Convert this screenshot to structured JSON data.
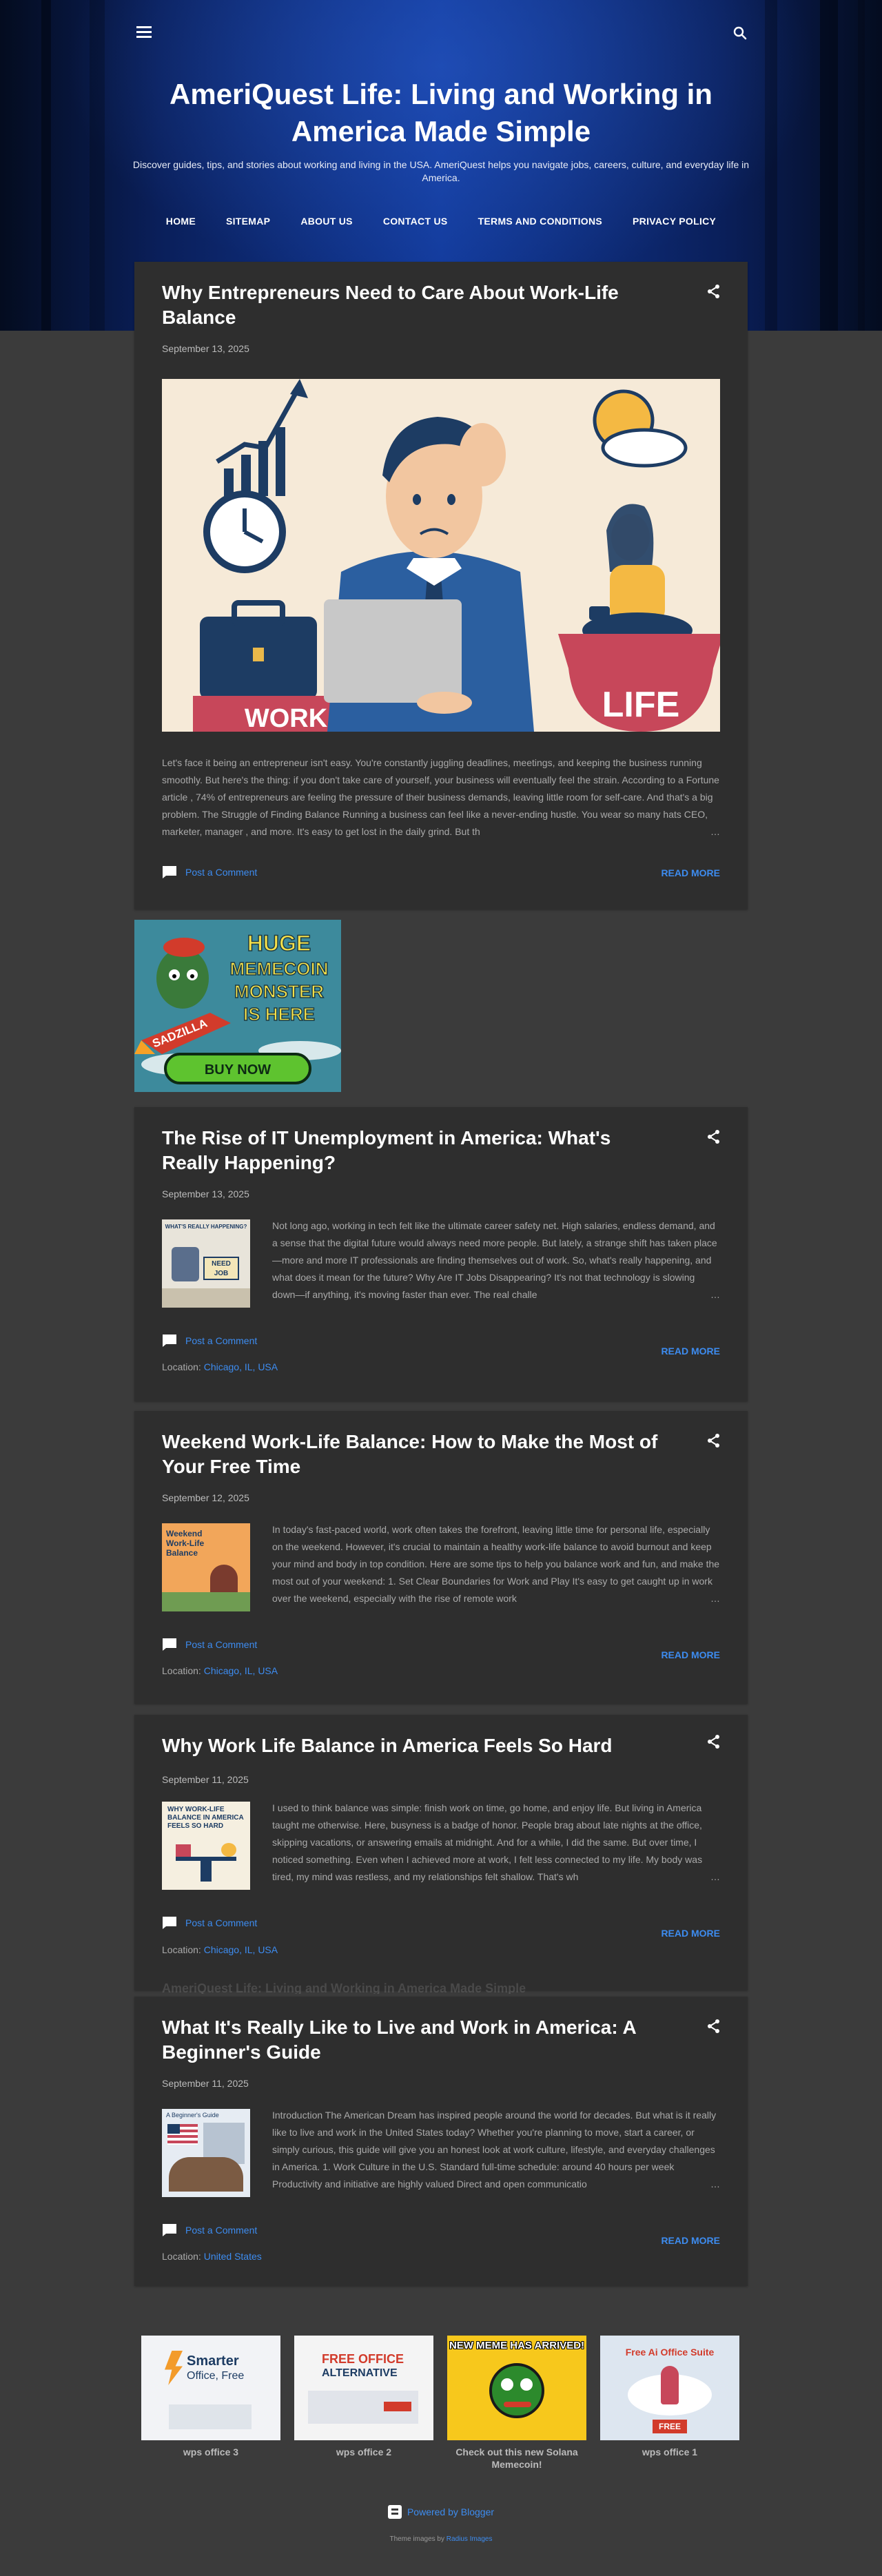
{
  "header": {
    "title": "AmeriQuest Life: Living and Working in America Made Simple",
    "description": "Discover guides, tips, and stories about working and living in the USA. AmeriQuest helps you navigate jobs, careers, culture, and everyday life in America."
  },
  "nav": [
    "HOME",
    "SITEMAP",
    "ABOUT US",
    "CONTACT US",
    "TERMS AND CONDITIONS",
    "PRIVACY POLICY"
  ],
  "labels": {
    "post_comment": "Post a Comment",
    "read_more": "READ MORE",
    "location_prefix": "Location:",
    "ellipsis": "…"
  },
  "featured": {
    "title": "Why Entrepreneurs Need to Care About Work-Life Balance",
    "date": "September 13, 2025",
    "image_text_left": "WORK",
    "image_text_right": "LIFE",
    "snippet": "Let's face it being an entrepreneur isn't easy. You're constantly juggling deadlines, meetings, and keeping the business running smoothly. But here's the thing: if you don't take care of yourself, your business will eventually feel the strain. According to a Fortune article , 74% of entrepreneurs are feeling the pressure of their business demands, leaving little room for self-care. And that's a big problem. The Struggle of Finding Balance Running a business can feel like a never-ending hustle. You wear so many hats  CEO, marketer, manager , and more. It's easy to get lost in the daily grind. But th"
  },
  "ad": {
    "line1": "HUGE",
    "line2": "MEMECOIN",
    "line3": "MONSTER",
    "line4": "IS HERE",
    "rocket": "SADZILLA",
    "button": "BUY NOW"
  },
  "posts": [
    {
      "title": "The Rise of IT Unemployment in America: What's Really Happening?",
      "date": "September 13, 2025",
      "thumb_caption": "WHAT'S REALLY HAPPENING?",
      "thumb_sign": "NEED JOB",
      "snippet": "Not long ago, working in tech felt like the ultimate career safety net. High salaries, endless demand, and a sense that the digital future would always need more people. But lately, a strange shift has taken place—more and more IT professionals are finding themselves out of work. So, what's really happening, and what does it mean for the future? Why Are IT Jobs Disappearing? It's not that technology is slowing down—if anything, it's moving faster than ever. The real challe",
      "location": "Chicago, IL, USA"
    },
    {
      "title": "Weekend Work-Life Balance: How to Make the Most of Your Free Time",
      "date": "September 12, 2025",
      "thumb_caption": "Weekend Work-Life Balance",
      "snippet": "In today's fast-paced world, work often takes the forefront, leaving little time for personal life, especially on the weekend. However, it's crucial to maintain a healthy work-life balance to avoid burnout and keep your mind and body in top condition. Here are some tips to help you balance work and fun, and make the most out of your weekend: 1. Set Clear Boundaries for Work and Play It's easy to get caught up in work over the weekend, especially with the rise of remote work",
      "location": "Chicago, IL, USA"
    },
    {
      "title": "Why Work Life Balance in America Feels So Hard",
      "date": "September 11, 2025",
      "thumb_caption": "WHY WORK-LIFE BALANCE IN AMERICA FEELS SO HARD",
      "snippet": "  I used to think balance was simple: finish work on time, go home, and enjoy life. But living in America taught me otherwise. Here, busyness is a badge of honor. People brag about late nights at the office, skipping vacations, or answering emails at midnight. And for a while, I did the same. But over time, I noticed something. Even when I achieved more at work, I felt less connected to my life. My body was tired, my mind was restless, and my relationships felt shallow. That's wh",
      "location": "Chicago, IL, USA"
    },
    {
      "title": "What It's Really Like to Live and Work in America: A Beginner's Guide",
      "date": "September 11, 2025",
      "thumb_caption": "A Beginner's Guide",
      "snippet": "Introduction The American Dream has inspired people around the world for decades. But what is it really like to live and work in the United States today? Whether you're planning to move, start a career, or simply curious, this guide will give you an honest look at work culture, lifestyle, and everyday challenges in America. 1. Work Culture in the U.S. Standard full-time schedule: around 40 hours per week Productivity and initiative are highly valued Direct and open communicatio",
      "location": "United States"
    }
  ],
  "ghost_title": "AmeriQuest Life: Living and Working in America Made Simple",
  "gadgets": [
    {
      "caption": "wps office 3",
      "img_line1": "Smarter",
      "img_line2": "Office, Free"
    },
    {
      "caption": "wps office 2",
      "img_line1": "FREE OFFICE",
      "img_line2": "ALTERNATIVE"
    },
    {
      "caption": "Check out this new Solana Memecoin!",
      "img_line1": "NEW MEME HAS ARRIVED!"
    },
    {
      "caption": "wps office 1",
      "img_line1": "Free Ai Office Suite",
      "img_line2": "FREE"
    }
  ],
  "footer": {
    "powered": "Powered by Blogger",
    "theme_prefix": "Theme images by",
    "theme_author": "Radius Images"
  },
  "colors": {
    "link": "#3d8cf0",
    "post_bg": "#2e2e2e",
    "page_bg": "#3b3b3b"
  }
}
